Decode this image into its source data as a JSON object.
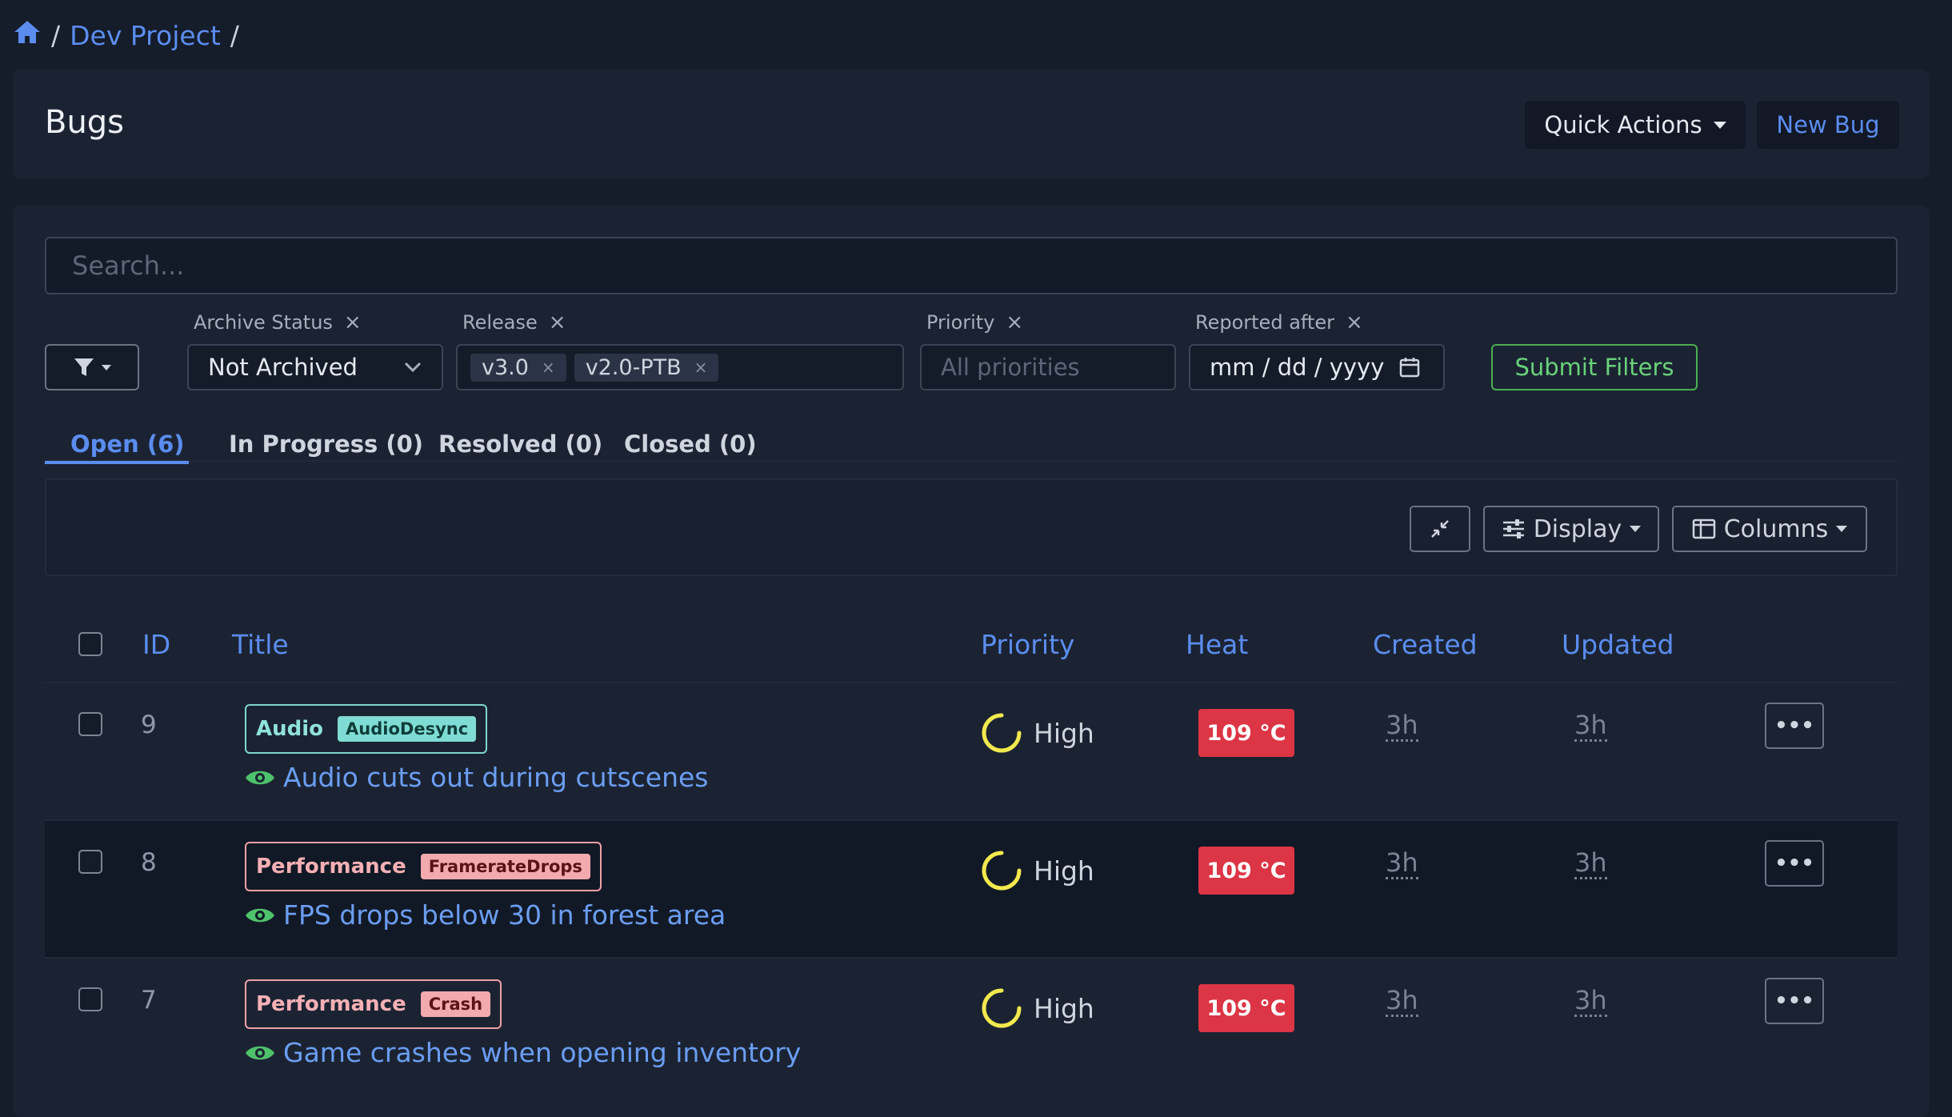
{
  "breadcrumb": {
    "separator": "/",
    "project": "Dev Project"
  },
  "header": {
    "title": "Bugs",
    "quick_actions": "Quick Actions",
    "new_bug": "New Bug"
  },
  "search": {
    "placeholder": "Search..."
  },
  "filters": {
    "archive_label": "Archive Status",
    "archive_value": "Not Archived",
    "release_label": "Release",
    "release_tags": [
      "v3.0",
      "v2.0-PTB"
    ],
    "priority_label": "Priority",
    "priority_placeholder": "All priorities",
    "reported_label": "Reported after",
    "reported_placeholder": "mm / dd / yyyy",
    "submit": "Submit Filters",
    "clear_glyph": "×"
  },
  "tabs": [
    "Open (6)",
    "In Progress (0)",
    "Resolved (0)",
    "Closed (0)"
  ],
  "toolbar": {
    "display": "Display",
    "columns": "Columns"
  },
  "table": {
    "headers": {
      "id": "ID",
      "title": "Title",
      "priority": "Priority",
      "heat": "Heat",
      "created": "Created",
      "updated": "Updated"
    },
    "rows": [
      {
        "id": "9",
        "category": "Audio",
        "subcategory": "AudioDesync",
        "title": "Audio cuts out during cutscenes",
        "priority": "High",
        "heat": "109 °C",
        "created": "3h",
        "updated": "3h",
        "more": "•••"
      },
      {
        "id": "8",
        "category": "Performance",
        "subcategory": "FramerateDrops",
        "title": "FPS drops below 30 in forest area",
        "priority": "High",
        "heat": "109 °C",
        "created": "3h",
        "updated": "3h",
        "more": "•••"
      },
      {
        "id": "7",
        "category": "Performance",
        "subcategory": "Crash",
        "title": "Game crashes when opening inventory",
        "priority": "High",
        "heat": "109 °C",
        "created": "3h",
        "updated": "3h",
        "more": "•••"
      }
    ]
  },
  "colors": {
    "accent": "#5b8def",
    "heat": "#dc3545",
    "submit": "#4caf50",
    "priority_ring": "#f2e94e"
  }
}
